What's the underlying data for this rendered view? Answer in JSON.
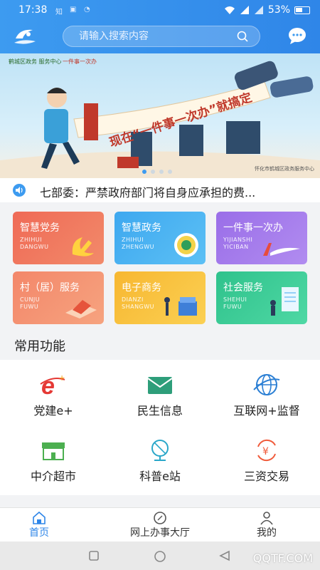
{
  "status": {
    "time": "17:38",
    "left_icons": [
      "知",
      "▣",
      "◔"
    ],
    "battery": "53%"
  },
  "search": {
    "placeholder": "请输入搜索内容"
  },
  "banner": {
    "brand_left": "鹤城区政务 服务中心",
    "brand_right": "一件事一次办",
    "slogan": "现在“一件事一次办”就搞定",
    "slogan_keyword": "就搞定",
    "credit": "怀化市鹤城区政务服务中心",
    "slide_count": 4,
    "active_slide": 1
  },
  "notice": {
    "text": "七部委：严禁政府部门将自身应承担的费..."
  },
  "tiles": [
    {
      "cn": "智慧党务",
      "py1": "ZHIHUI",
      "py2": "DANGWU",
      "color1": "#ef6a56",
      "color2": "#f28a6a"
    },
    {
      "cn": "智慧政务",
      "py1": "ZHIHUI",
      "py2": "ZHENGWU",
      "color1": "#3ea8ef",
      "color2": "#5cc0f5"
    },
    {
      "cn": "一件事一次办",
      "py1": "YIJIANSHI",
      "py2": "YICIBAN",
      "color1": "#9a6ee8",
      "color2": "#b18cf0"
    },
    {
      "cn": "村（居）服务",
      "py1": "CUNJU",
      "py2": "FUWU",
      "color1": "#f3876a",
      "color2": "#f6a37f"
    },
    {
      "cn": "电子商务",
      "py1": "DIANZI",
      "py2": "SHANGWU",
      "color1": "#f7b731",
      "color2": "#fbd053"
    },
    {
      "cn": "社会服务",
      "py1": "SHEHUI",
      "py2": "FUWU",
      "color1": "#2fc28c",
      "color2": "#4fd8a4"
    }
  ],
  "section": {
    "title": "常用功能"
  },
  "functions": [
    {
      "label": "党建e+",
      "icon": "e-plus-icon"
    },
    {
      "label": "民生信息",
      "icon": "mail-icon"
    },
    {
      "label": "互联网+监督",
      "icon": "globe-icon"
    },
    {
      "label": "中介超市",
      "icon": "store-icon"
    },
    {
      "label": "科普e站",
      "icon": "desk-globe-icon"
    },
    {
      "label": "三资交易",
      "icon": "yuan-cycle-icon"
    }
  ],
  "nav": [
    {
      "label": "首页",
      "icon": "home-icon",
      "active": true
    },
    {
      "label": "网上办事大厅",
      "icon": "compass-icon",
      "active": false
    },
    {
      "label": "我的",
      "icon": "user-icon",
      "active": false
    }
  ],
  "watermark": "QQTF.COM"
}
